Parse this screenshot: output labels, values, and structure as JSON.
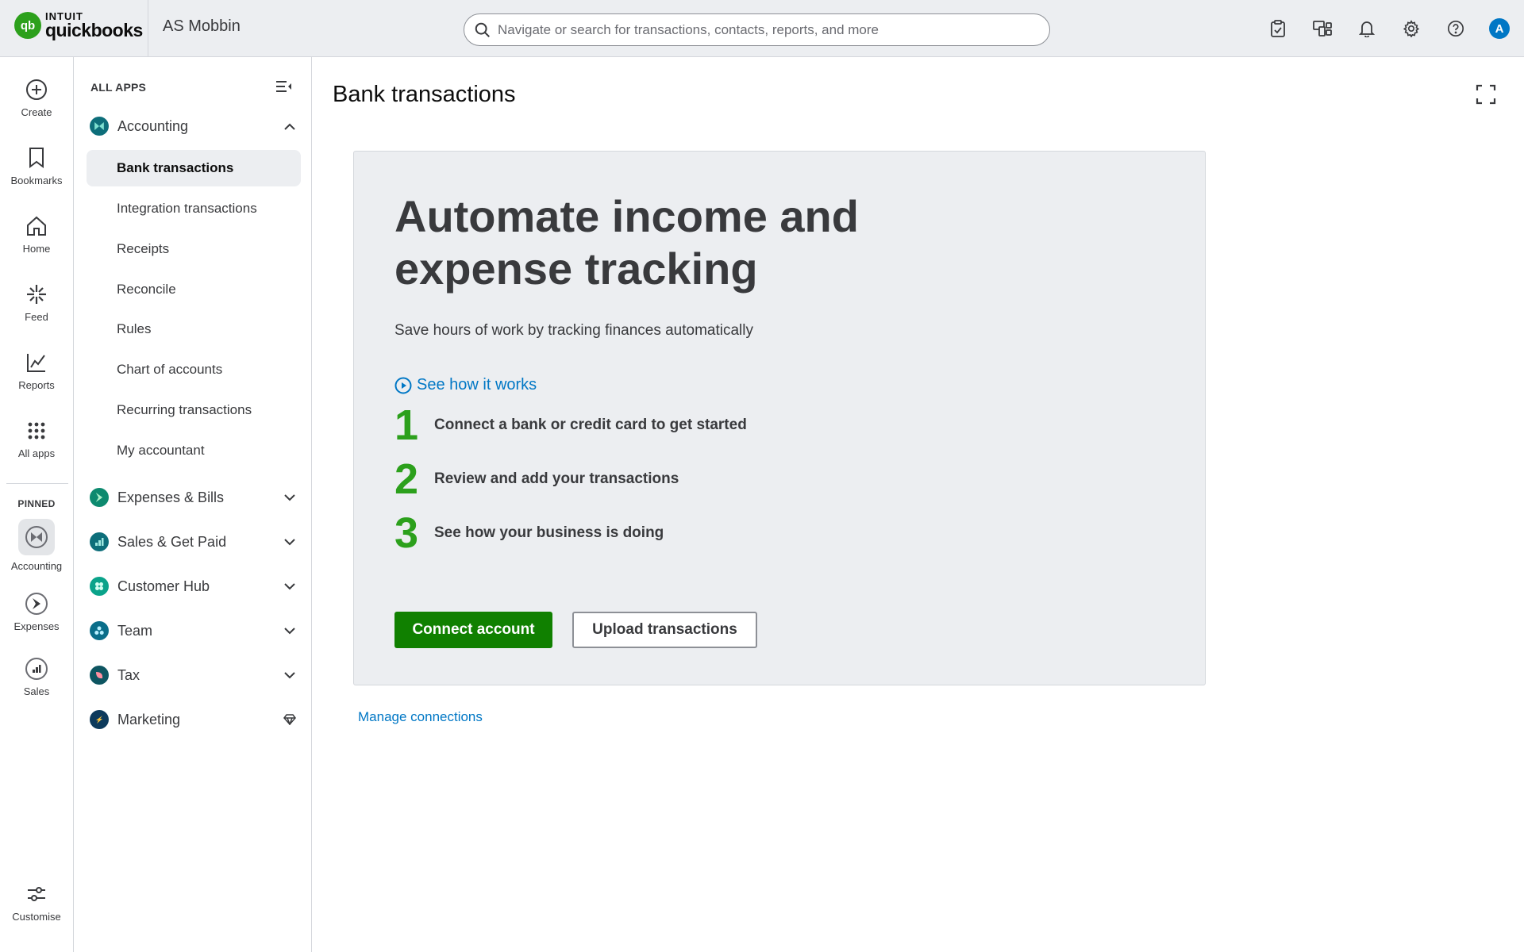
{
  "header": {
    "brand_top": "INTUIT",
    "brand_bottom": "quickbooks",
    "company": "AS Mobbin",
    "search_placeholder": "Navigate or search for transactions, contacts, reports, and more",
    "avatar_initial": "A",
    "icons": [
      "clipboard-check-icon",
      "apps-switcher-icon",
      "bell-icon",
      "gear-icon",
      "help-icon"
    ]
  },
  "rail": {
    "items": [
      {
        "label": "Create",
        "icon": "plus-circle-icon"
      },
      {
        "label": "Bookmarks",
        "icon": "bookmark-icon"
      },
      {
        "label": "Home",
        "icon": "home-icon"
      },
      {
        "label": "Feed",
        "icon": "sparkle-icon"
      },
      {
        "label": "Reports",
        "icon": "line-chart-icon"
      },
      {
        "label": "All apps",
        "icon": "grid-dots-icon"
      }
    ],
    "pinned_heading": "PINNED",
    "pinned": [
      {
        "label": "Accounting",
        "icon": "accounting-icon"
      },
      {
        "label": "Expenses",
        "icon": "expenses-icon"
      },
      {
        "label": "Sales",
        "icon": "sales-icon"
      }
    ],
    "customise": {
      "label": "Customise",
      "icon": "sliders-icon"
    }
  },
  "appnav": {
    "heading": "ALL APPS",
    "accounting": {
      "label": "Accounting",
      "items": [
        "Bank transactions",
        "Integration transactions",
        "Receipts",
        "Reconcile",
        "Rules",
        "Chart of accounts",
        "Recurring transactions",
        "My accountant"
      ],
      "active_index": 0
    },
    "groups": [
      {
        "label": "Expenses & Bills",
        "color": "#0d8a6f"
      },
      {
        "label": "Sales & Get Paid",
        "color": "#0d6e7a"
      },
      {
        "label": "Customer Hub",
        "color": "#0aa38a"
      },
      {
        "label": "Team",
        "color": "#0a6e8a"
      },
      {
        "label": "Tax",
        "color": "#0d5561"
      },
      {
        "label": "Marketing",
        "color": "#0d3a5c"
      }
    ]
  },
  "main": {
    "title": "Bank transactions",
    "hero_line1": "Automate income and",
    "hero_line2": "expense tracking",
    "subtitle": "Save hours of work by tracking finances automatically",
    "see_how": "See how it works",
    "steps": [
      {
        "num": "1",
        "text": "Connect a bank or credit card to get started"
      },
      {
        "num": "2",
        "text": "Review and add your transactions"
      },
      {
        "num": "3",
        "text": "See how your business is doing"
      }
    ],
    "primary_button": "Connect account",
    "secondary_button": "Upload transactions",
    "manage_link": "Manage connections"
  },
  "colors": {
    "accent_green": "#2ca01c",
    "button_green": "#108000",
    "link_blue": "#0077c5"
  }
}
